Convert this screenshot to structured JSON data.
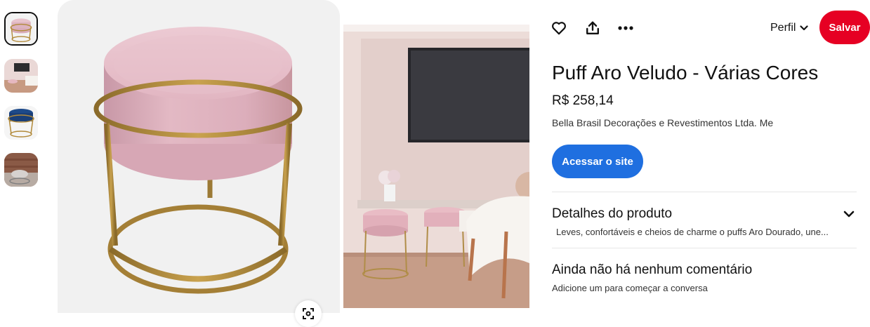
{
  "toolbar": {
    "like_icon": "heart-icon",
    "share_icon": "share-icon",
    "more_icon": "more-icon",
    "profile_label": "Perfil",
    "save_label": "Salvar",
    "save_color": "#e60023"
  },
  "product": {
    "title": "Puff Aro Veludo - Várias Cores",
    "price": "R$ 258,14",
    "seller": "Bella Brasil Decorações e Revestimentos Ltda. Me",
    "visit_label": "Acessar o site",
    "visit_color": "#1f6fe0"
  },
  "details": {
    "title": "Detalhes do produto",
    "description": "Leves, confortáveis e cheios de charme o puffs Aro Dourado, une..."
  },
  "comments": {
    "title": "Ainda não há nenhum comentário",
    "subtitle": "Adicione um para começar a conversa"
  },
  "thumbnails": [
    "pink-puff",
    "pink-room",
    "blue-puff",
    "brick-room"
  ]
}
